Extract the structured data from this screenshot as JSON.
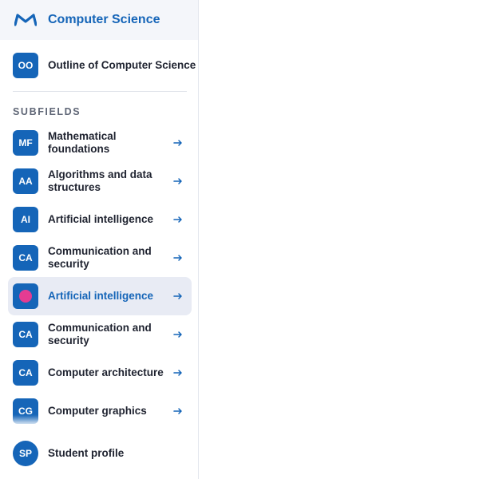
{
  "colors": {
    "brand": "#1565b8",
    "active_bg": "#e8ebf4",
    "active_dot": "#e53c92",
    "header_bg": "#f4f6fa"
  },
  "header": {
    "logo_icon": "m-logo-icon",
    "title": "Computer Science"
  },
  "outline": {
    "badge": "OO",
    "label": "Outline of Computer Science"
  },
  "subfields": {
    "heading": "SUBFIELDS",
    "items": [
      {
        "badge": "MF",
        "label": "Mathematical foundations",
        "icon": "arrow-right-icon"
      },
      {
        "badge": "AA",
        "label": "Algorithms and data structures",
        "icon": "arrow-right-icon"
      },
      {
        "badge": "AI",
        "label": "Artificial intelligence",
        "icon": "arrow-right-icon"
      },
      {
        "badge": "CA",
        "label": "Communication and security",
        "icon": "arrow-right-icon"
      },
      {
        "badge": "",
        "label": "Artificial intelligence",
        "icon": "arrow-right-icon",
        "active": true
      },
      {
        "badge": "CA",
        "label": "Communication and security",
        "icon": "arrow-right-icon"
      },
      {
        "badge": "CA",
        "label": "Computer architecture",
        "icon": "arrow-right-icon"
      },
      {
        "badge": "CG",
        "label": "Computer graphics",
        "icon": "arrow-right-icon"
      }
    ]
  },
  "footer": {
    "avatar": "SP",
    "label": "Student profile"
  }
}
